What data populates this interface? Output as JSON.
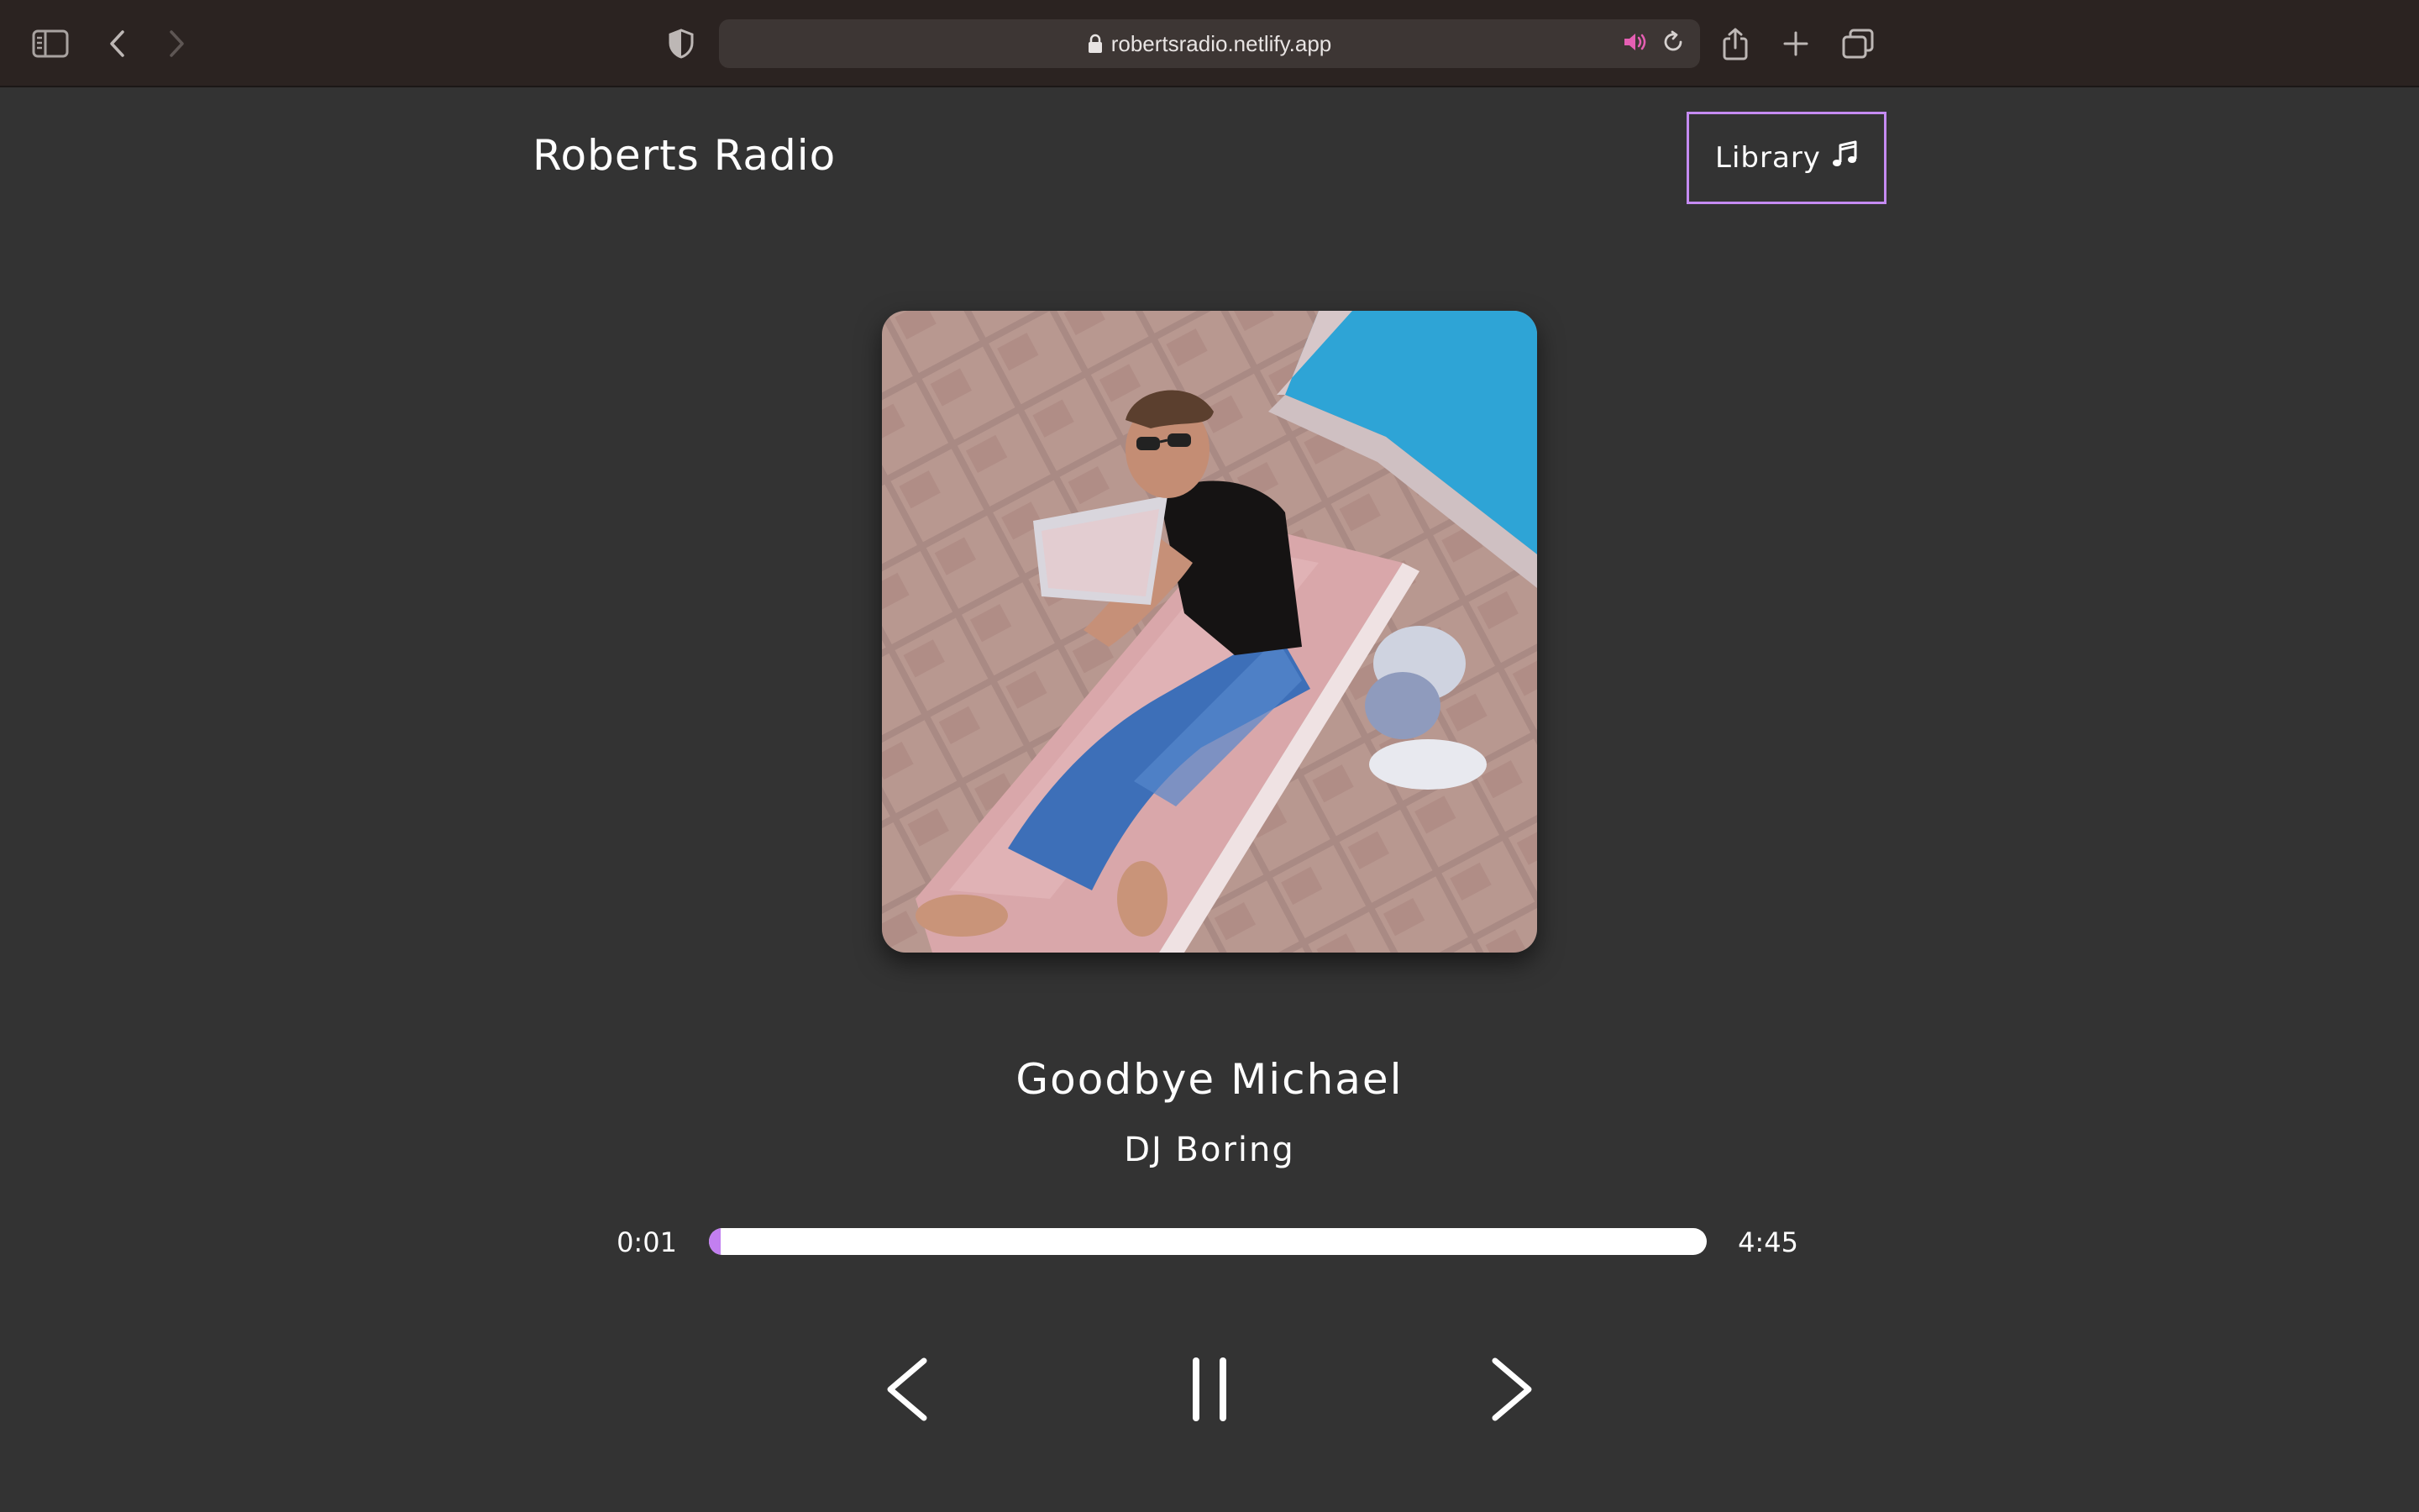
{
  "browser": {
    "url": "robertsradio.netlify.app",
    "icons": {
      "sidebar": "sidebar-icon",
      "back": "chevron-left-icon",
      "forward": "chevron-right-icon",
      "privacy": "shield-icon",
      "lock": "lock-icon",
      "audio": "speaker-icon",
      "reload": "reload-icon",
      "share": "share-icon",
      "new_tab": "plus-icon",
      "tabs": "tabs-overview-icon"
    },
    "audio_icon_color": "#e55fb3"
  },
  "header": {
    "title": "Roberts Radio",
    "library_label": "Library",
    "library_icon": "music-note-icon"
  },
  "player": {
    "album_art": "album-cover-image",
    "song_title": "Goodbye Michael",
    "artist": "DJ Boring",
    "current_time": "0:01",
    "total_time": "4:45",
    "progress_fraction": 0.0035,
    "accent_color": "#c27ff0",
    "controls": {
      "prev": "chevron-left-icon",
      "play_pause": "pause-icon",
      "next": "chevron-right-icon"
    }
  }
}
